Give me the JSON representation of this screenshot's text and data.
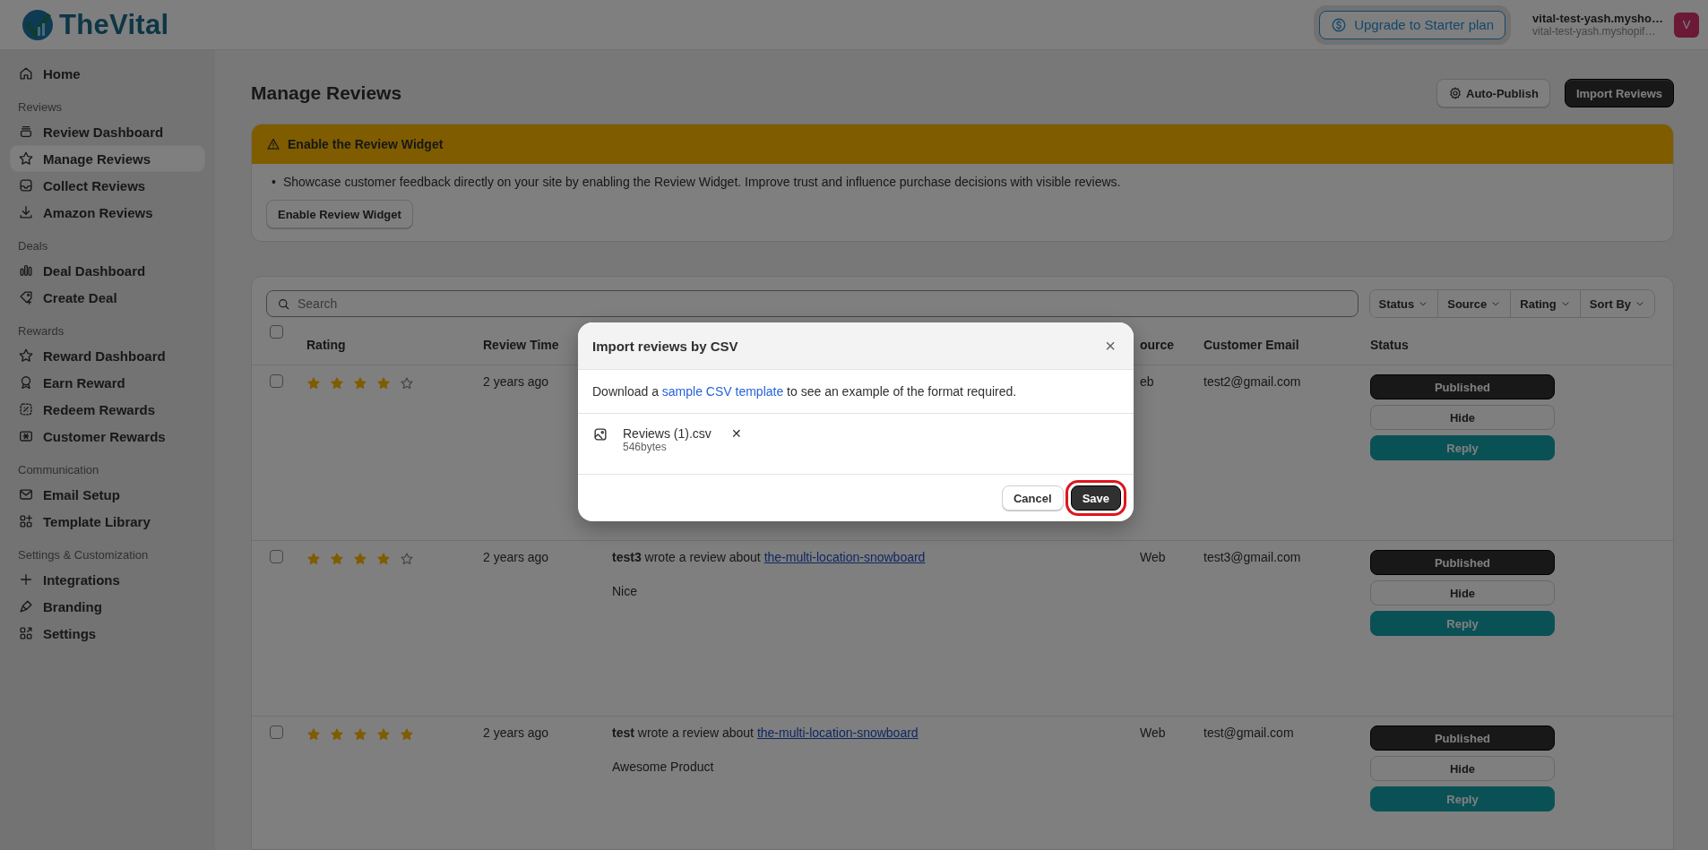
{
  "topbar": {
    "logo": "TheVital",
    "upgrade_button": "Upgrade to Starter plan",
    "store_name": "vital-test-yash.mysho…",
    "store_domain": "vital-test-yash.myshopif…",
    "avatar": "V"
  },
  "sidebar": {
    "groups": [
      {
        "items": [
          {
            "label": "Home",
            "selected": false
          }
        ]
      },
      {
        "title": "Reviews",
        "items": [
          {
            "label": "Review Dashboard",
            "selected": false
          },
          {
            "label": "Manage Reviews",
            "selected": true
          },
          {
            "label": "Collect Reviews",
            "selected": false
          },
          {
            "label": "Amazon Reviews",
            "selected": false
          }
        ]
      },
      {
        "title": "Deals",
        "items": [
          {
            "label": "Deal Dashboard",
            "selected": false
          },
          {
            "label": "Create Deal",
            "selected": false
          }
        ]
      },
      {
        "title": "Rewards",
        "items": [
          {
            "label": "Reward Dashboard",
            "selected": false
          },
          {
            "label": "Earn Reward",
            "selected": false
          },
          {
            "label": "Redeem Rewards",
            "selected": false
          },
          {
            "label": "Customer Rewards",
            "selected": false
          }
        ]
      },
      {
        "title": "Communication",
        "items": [
          {
            "label": "Email Setup",
            "selected": false
          },
          {
            "label": "Template Library",
            "selected": false
          }
        ]
      },
      {
        "title": "Settings & Customization",
        "items": [
          {
            "label": "Integrations",
            "selected": false
          },
          {
            "label": "Branding",
            "selected": false
          },
          {
            "label": "Settings",
            "selected": false
          }
        ]
      }
    ]
  },
  "page": {
    "title": "Manage Reviews",
    "actions": [
      {
        "label": "Auto-Publish",
        "kind": "secondary"
      },
      {
        "label": "Import Reviews",
        "kind": "primary"
      }
    ]
  },
  "banner": {
    "title": "Enable the Review Widget",
    "bullets": [
      {
        "marker": "•",
        "text": "Showcase customer feedback directly on your site by enabling the Review Widget. Improve trust and influence purchase decisions with visible reviews."
      }
    ],
    "button": "Enable Review Widget"
  },
  "table": {
    "search": {
      "placeholder": "Search"
    },
    "filters": [
      "Status",
      "Source",
      "Rating",
      "Sort By"
    ],
    "header_checked": false,
    "columns": [
      "Rating",
      "Review Time",
      "",
      "ource",
      "Customer Email",
      "Status"
    ],
    "rows": [
      {
        "checked": false,
        "stars": 4,
        "time": "2 years ago",
        "source": "eb",
        "email": "test2@gmail.com",
        "actions": [
          "Published",
          "Hide",
          "Reply"
        ]
      },
      {
        "checked": false,
        "stars": 4,
        "time": "2 years ago",
        "author": "test3",
        "verb": "wrote a review about",
        "product": "the-multi-location-snowboard",
        "body": "Nice",
        "source": "Web",
        "email": "test3@gmail.com",
        "actions": [
          "Published",
          "Hide",
          "Reply"
        ]
      },
      {
        "checked": false,
        "stars": 5,
        "time": "2 years ago",
        "author": "test",
        "verb": "wrote a review about",
        "product": "the-multi-location-snowboard",
        "body": "Awesome Product",
        "source": "Web",
        "email": "test@gmail.com",
        "actions": [
          "Published",
          "Hide",
          "Reply"
        ]
      }
    ]
  },
  "modal": {
    "title": "Import reviews by CSV",
    "close": "×",
    "text_before": "Download a ",
    "link": "sample CSV template",
    "text_after": " to see an example of the format required.",
    "file": {
      "name": "Reviews (1).csv",
      "size": "546bytes",
      "remove": "✕"
    },
    "buttons": [
      {
        "label": "Cancel",
        "kind": "secondary",
        "highlighted": false
      },
      {
        "label": "Save",
        "kind": "primary",
        "highlighted": true
      }
    ]
  }
}
